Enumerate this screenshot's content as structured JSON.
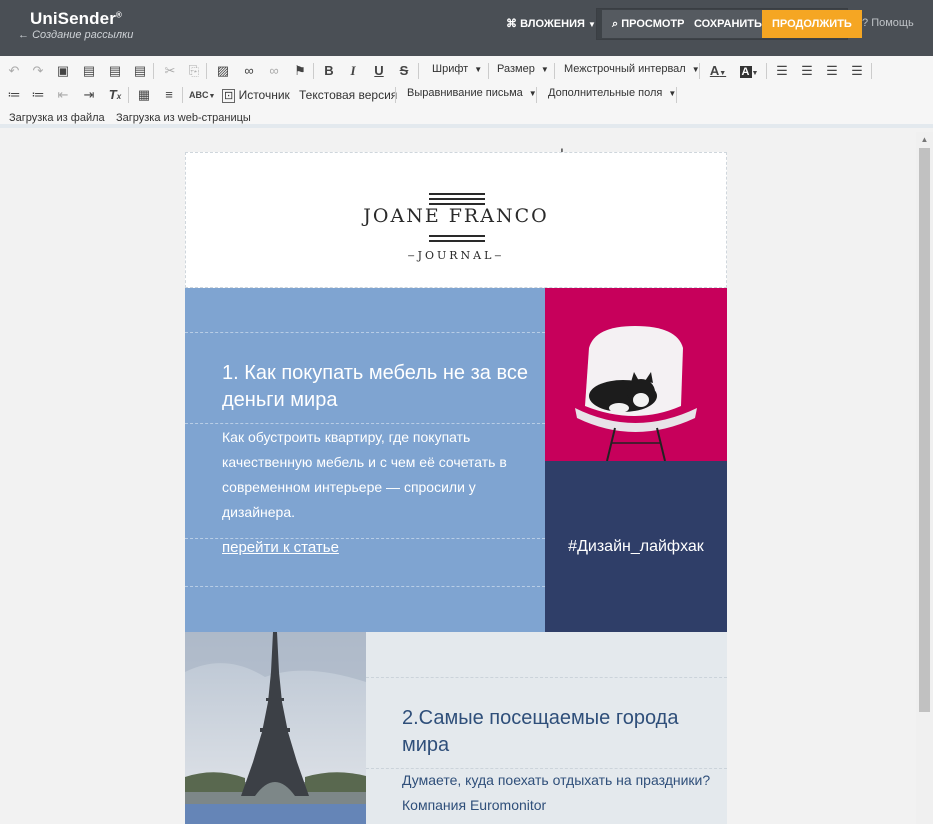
{
  "app": {
    "logo": "UniSender",
    "logo_mark": "®",
    "back_link": "Создание рассылки"
  },
  "header": {
    "attachments": "ВЛОЖЕНИЯ",
    "preview": "ПРОСМОТР",
    "save": "СОХРАНИТЬ",
    "continue": "ПРОДОЛЖИТЬ",
    "help": "Помощь",
    "accent_color": "#f5a623"
  },
  "toolbar": {
    "font": "Шрифт",
    "size": "Размер",
    "line_spacing": "Межстрочный интервал",
    "source": "Источник",
    "text_version": "Текстовая версия",
    "align_letter": "Выравнивание письма",
    "extra_fields": "Дополнительные поля",
    "bold": "B",
    "italic": "I",
    "underline": "U",
    "strike": "S"
  },
  "load": {
    "from_file": "Загрузка из файла",
    "from_web": "Загрузка из web-страницы"
  },
  "email": {
    "brand_name": "JOANE FRANCO",
    "brand_sub": "JOURNAL",
    "article1": {
      "title": "1. Как покупать мебель не за все деньги мира",
      "text": "Как обустроить квартиру, где покупать качественную мебель и с чем её сочетать в современном интерьере — спросили у дизайнера.",
      "link": "перейти к статье"
    },
    "hashtag": "#Дизайн_лайфхак",
    "article2": {
      "title": "2.Самые посещаемые города мира",
      "text": "Думаете, куда поехать отдыхать на праздники? Компания Euromonitor"
    }
  }
}
